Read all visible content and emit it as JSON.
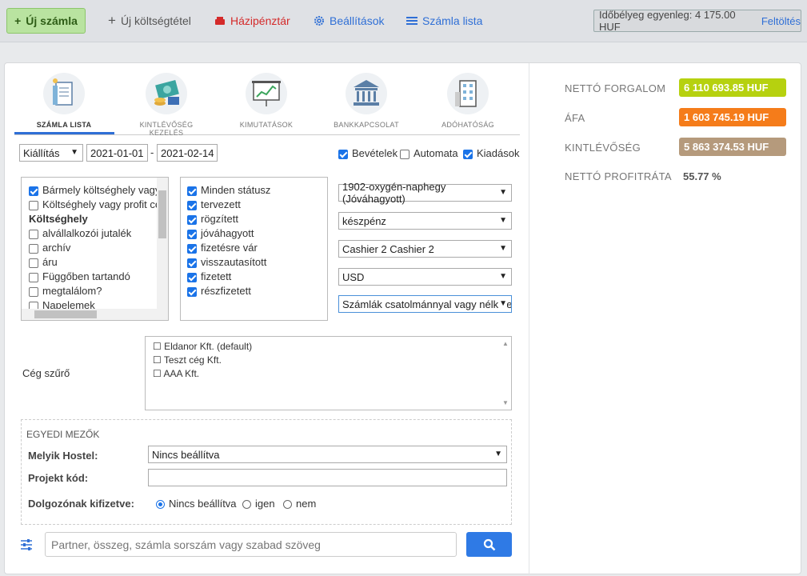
{
  "toolbar": {
    "new_invoice": "Új számla",
    "new_expense": "Új költségtétel",
    "cash_register": "Házipénztár",
    "settings": "Beállítások",
    "invoice_list": "Számla lista",
    "stamp_balance": "Időbélyeg egyenleg: 4 175.00 HUF",
    "top_up": "Feltöltés"
  },
  "tabs": [
    {
      "label": "SZÁMLA LISTA",
      "icon": "invoice-list-icon",
      "active": true
    },
    {
      "label": "KINTLÉVŐSÉG KEZELÉS",
      "icon": "money-icon"
    },
    {
      "label": "KIMUTATÁSOK",
      "icon": "presentation-chart-icon"
    },
    {
      "label": "BANKKAPCSOLAT",
      "icon": "bank-icon"
    },
    {
      "label": "ADÓHATÓSÁG",
      "icon": "building-icon"
    }
  ],
  "filters": {
    "date_type": "Kiállítás",
    "date_from": "2021-01-01",
    "date_sep": "-",
    "date_to": "2021-02-14",
    "income": "Bevételek",
    "automatic": "Automata",
    "expenses": "Kiadások"
  },
  "cost_centers": {
    "items": [
      "Bármely költséghely vagy",
      "Költséghely vagy profit ce",
      "Költséghely",
      "alvállalkozói jutalék",
      "archív",
      "áru",
      "Függőben tartandó",
      "megtalálom?",
      "Napelemek"
    ]
  },
  "statuses": {
    "items": [
      "Minden státusz",
      "tervezett",
      "rögzített",
      "jóváhagyott",
      "fizetésre vár",
      "visszautasított",
      "fizetett",
      "részfizetett"
    ]
  },
  "dropdowns": {
    "account": "1902-oxygén-naphegy (Jóváhagyott)",
    "payment": "készpénz",
    "cashier": "Cashier 2 Cashier 2",
    "currency": "USD",
    "attachments": "Számlák csatolmánnyal vagy nélküle"
  },
  "company_filter": {
    "label": "Cég szűrő",
    "items": [
      "Eldanor Kft. (default)",
      "Teszt cég Kft.",
      "AAA Kft."
    ]
  },
  "custom_fields": {
    "title": "EGYEDI MEZŐK",
    "hostel_label": "Melyik Hostel:",
    "hostel_value": "Nincs beállítva",
    "project_label": "Projekt kód:",
    "project_value": "",
    "paid_label": "Dolgozónak kifizetve:",
    "opt_none": "Nincs beállítva",
    "opt_yes": "igen",
    "opt_no": "nem"
  },
  "search": {
    "placeholder": "Partner, összeg, számla sorszám vagy szabad szöveg"
  },
  "stats": {
    "net_turnover_label": "NETTÓ FORGALOM",
    "net_turnover_value": "6 110 693.85 HUF",
    "vat_label": "ÁFA",
    "vat_value": "1 603 745.19 HUF",
    "receivables_label": "KINTLÉVŐSÉG",
    "receivables_value": "5 863 374.53 HUF",
    "profit_label": "NETTÓ PROFITRÁTA",
    "profit_value": "55.77 %"
  },
  "colors": {
    "turnover": "#b6d10f",
    "vat": "#f57c1a",
    "receivables": "#b59a7c",
    "accent": "#2f6fd6"
  }
}
